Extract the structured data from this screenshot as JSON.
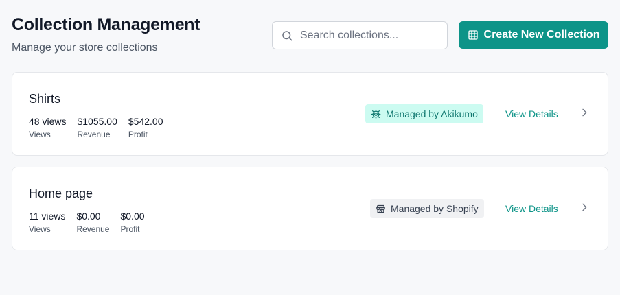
{
  "header": {
    "title": "Collection Management",
    "subtitle": "Manage your store collections"
  },
  "search": {
    "placeholder": "Search collections...",
    "icon": "search-icon"
  },
  "create_button": {
    "label": "Create New Collection",
    "icon": "grid-table-icon"
  },
  "collections": [
    {
      "name": "Shirts",
      "views_value": "48 views",
      "views_label": "Views",
      "revenue_value": "$1055.00",
      "revenue_label": "Revenue",
      "profit_value": "$542.00",
      "profit_label": "Profit",
      "managed_by": "Managed by Akikumo",
      "badge_icon": "gear-icon",
      "action_label": "View Details"
    },
    {
      "name": "Home page",
      "views_value": "11 views",
      "views_label": "Views",
      "revenue_value": "$0.00",
      "revenue_label": "Revenue",
      "profit_value": "$0.00",
      "profit_label": "Profit",
      "managed_by": "Managed by Shopify",
      "badge_icon": "store-icon",
      "action_label": "View Details"
    }
  ],
  "colors": {
    "accent": "#0d9488",
    "background": "#f7f8fa",
    "akikumo_badge_bg": "#ccfbf1",
    "shopify_badge_bg": "#f0f1f3"
  }
}
